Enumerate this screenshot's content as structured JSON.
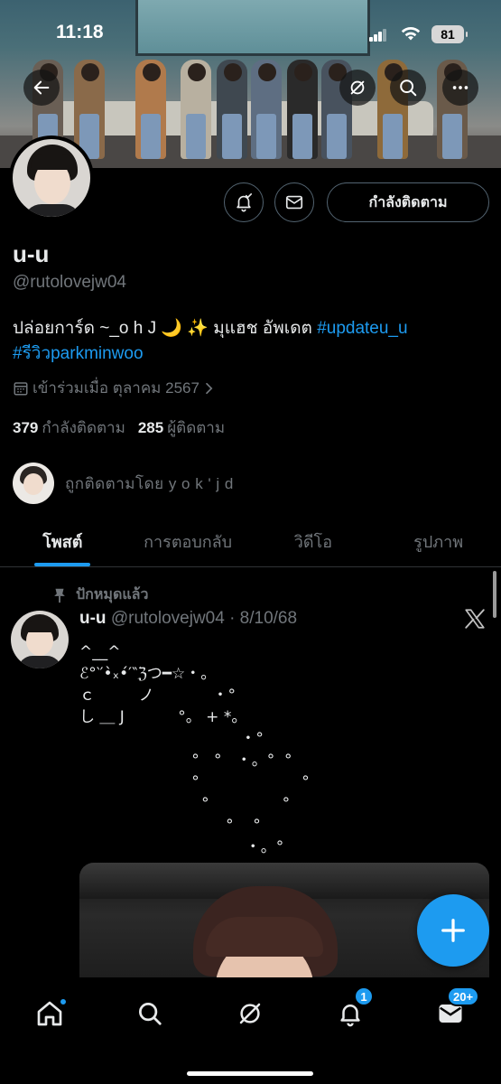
{
  "status_bar": {
    "time": "11:18",
    "battery": "81"
  },
  "profile": {
    "name": "u-u",
    "handle": "@rutolovejw04",
    "bio_text": "ปล่อยการ์ด ~_o h J 🌙 ✨ มุแฮช อัพเดต ",
    "bio_link_1": "#updateu_u",
    "bio_link_2": "#รีวิวparkminwoo",
    "joined": "เข้าร่วมเมื่อ ตุลาคม 2567",
    "following_count": "379",
    "following_label": "กำลังติดตาม",
    "followers_count": "285",
    "followers_label": "ผู้ติดตาม",
    "followed_by": "ถูกติดตามโดย y o k ' j d",
    "follow_button": "กำลังติดตาม"
  },
  "tabs": [
    {
      "label": "โพสต์"
    },
    {
      "label": "การตอบกลับ"
    },
    {
      "label": "วิดีโอ"
    },
    {
      "label": "รูปภาพ"
    }
  ],
  "post": {
    "pinned_label": "ปักหมุดแล้ว",
    "author": "u-u",
    "handle_date": " @rutolovejw04 · 8/10/68",
    "text": "^__^\nℰ°‵′•̀ₓ•́′‶ℨつ━☆・。\nｃ         ノ            ・°\nし ＿ J           °。 + *。\n                                 ・°\n                       °   °   ・。°  °\n                       °                     °\n                         °               °\n                              °    °\n                                  ・。°"
  },
  "nav": {
    "messages_badge": "20+",
    "notifications_badge": "1"
  },
  "colors": {
    "accent": "#1d9bf0",
    "background": "#000000",
    "muted_text": "#71767b"
  }
}
